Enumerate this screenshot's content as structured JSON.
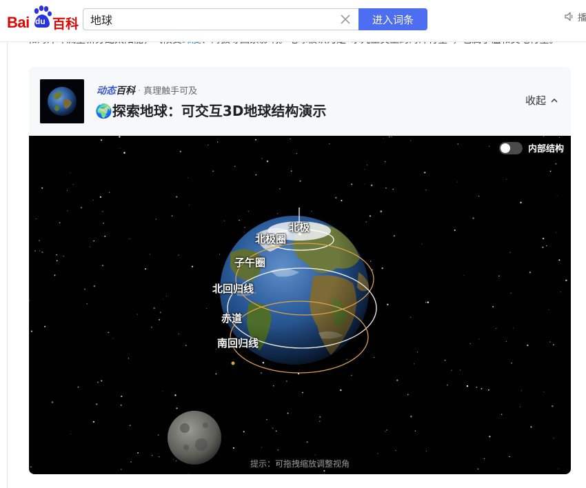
{
  "header": {
    "logo_en": "Bai",
    "logo_du": "du",
    "logo_cn": "百科",
    "search_value": "地球",
    "search_button": "进入词条",
    "audio_label": "播"
  },
  "intro": {
    "text_before": "和海洋环流重新分配太阳能，气候受",
    "link": "纬度",
    "text_after": "、海拔等因素影响。地球被认为是“水九主类型的海洋行星”，也属于温和类地行星。"
  },
  "card": {
    "badge_a": "动态",
    "badge_b": "百科",
    "slogan": "真理触手可及",
    "title": "🌍探索地球：可交互3D地球结构演示",
    "collapse": "收起",
    "toggle_label": "内部结构",
    "toggle_on": false,
    "hint": "提示：可拖拽缩放调整视角",
    "globe_labels": {
      "north_pole": "北极",
      "arctic_circle": "北极圈",
      "meridian": "子午圈",
      "tropic_cancer": "北回归线",
      "equator": "赤道",
      "tropic_capricorn": "南回归线"
    }
  },
  "colors": {
    "brand_red": "#e10601",
    "brand_blue": "#4e6ef2",
    "link": "#136ec2",
    "tropic_line": "#e0a24a",
    "equator_line": "#f1f1f1"
  },
  "icons": [
    "clear-icon",
    "audio-icon",
    "chevron-up-icon",
    "baidu-paw-logo"
  ]
}
